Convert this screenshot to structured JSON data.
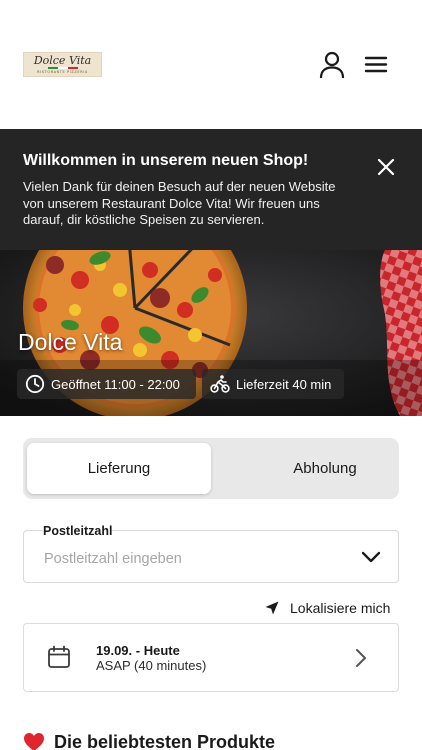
{
  "header": {
    "logo": {
      "text": "Dolce Vita",
      "subtitle": "RISTORANTE PIZZERIA"
    },
    "icons": [
      "user-icon",
      "menu-icon"
    ]
  },
  "banner": {
    "title": "Willkommen in unserem neuen Shop!",
    "text": "Vielen Dank für deinen Besuch auf der neuen Website von unserem Restaurant Dolce Vita! Wir freuen uns darauf, dir köstliche Speisen zu servieren.",
    "close_icon": "close-icon"
  },
  "hero": {
    "restaurant_name": "Dolce Vita",
    "opening_hours": "Geöffnet 11:00 - 22:00",
    "delivery_time": "Lieferzeit 40 min"
  },
  "order_type": {
    "options": [
      "Lieferung",
      "Abholung"
    ],
    "selected": "Lieferung"
  },
  "postcode": {
    "label": "Postleitzahl",
    "placeholder": "Postleitzahl eingeben",
    "value": ""
  },
  "locate": {
    "label": "Lokalisiere mich"
  },
  "schedule": {
    "date": "19.09. - Heute",
    "time": "ASAP (40 minutes)"
  },
  "popular": {
    "heading": "Die beliebtesten Produkte"
  },
  "colors": {
    "banner_bg": "#252525",
    "toggle_bg": "#e8e8e8",
    "heart": "#e0252e",
    "text": "#1a1a1a"
  }
}
